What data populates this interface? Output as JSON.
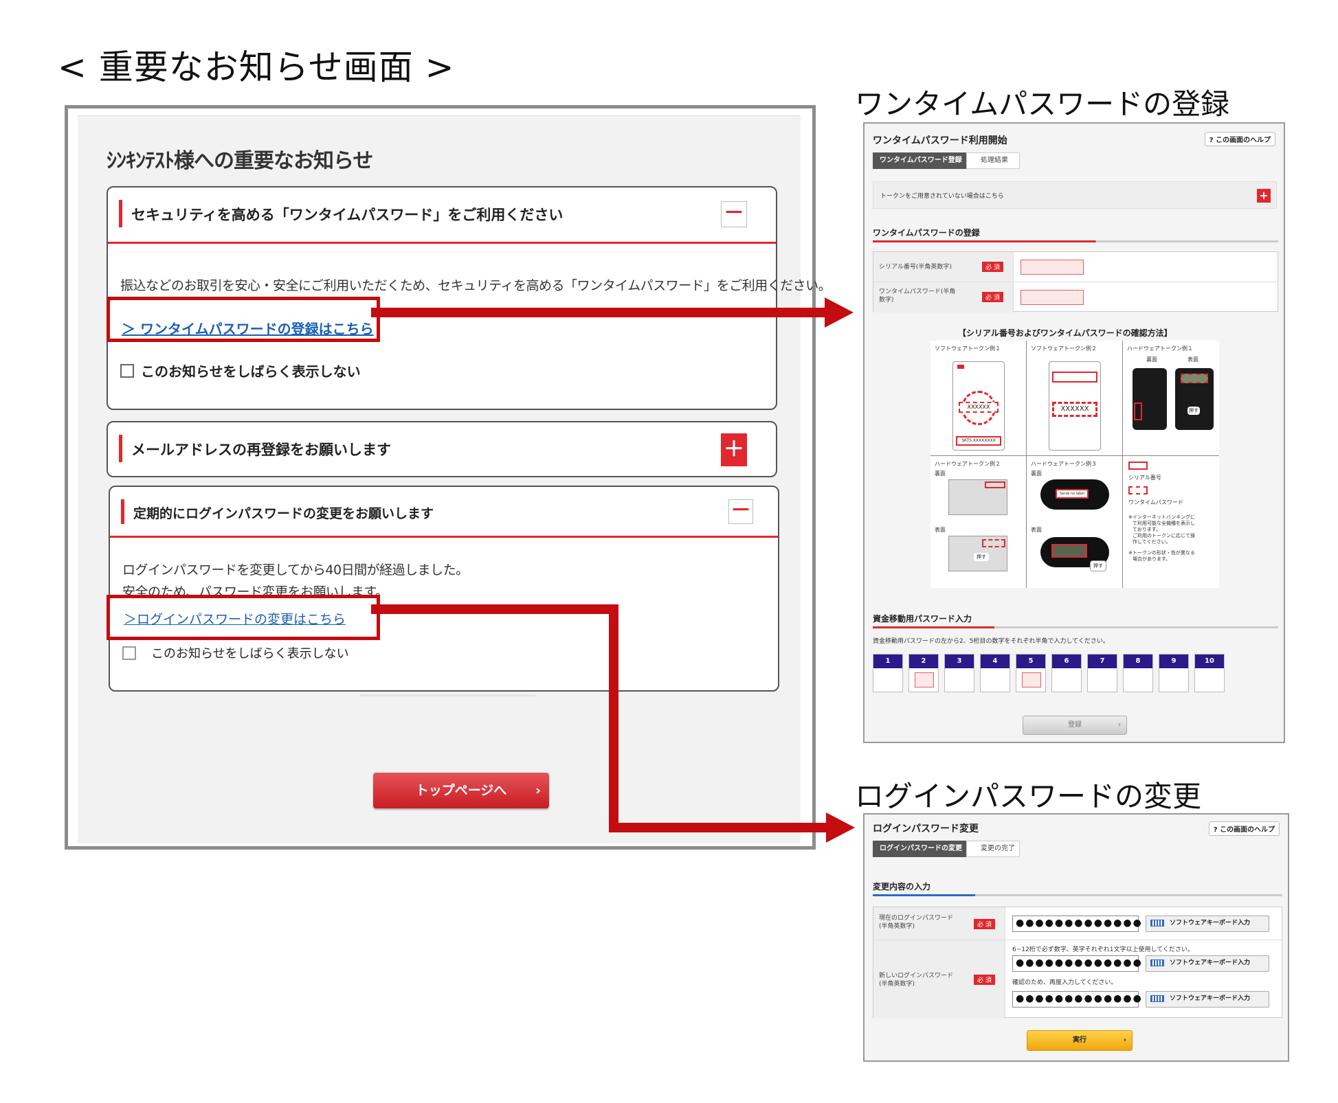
{
  "page_title": "< 重要なお知らせ画面 >",
  "main": {
    "heading": "ｼﾝｷﾝﾃｽﾄ様への重要なお知らせ",
    "sections": [
      {
        "title": "セキュリティを高める「ワンタイムパスワード」をご利用ください",
        "toggle": "－",
        "body": "振込などのお取引を安心・安全にご利用いただくため、セキュリティを高める「ワンタイムパスワード」をご利用ください。",
        "link": "＞ ワンタイムパスワードの登録はこちら",
        "checkbox_label": "このお知らせをしばらく表示しない"
      },
      {
        "title": "メールアドレスの再登録をお願いします",
        "toggle": "＋"
      },
      {
        "title": "定期的にログインパスワードの変更をお願いします",
        "toggle": "－",
        "body_line1": "ログインパスワードを変更してから40日間が経過しました。",
        "body_line2": "安全のため、パスワード変更をお願いします。",
        "link": "＞ログインパスワードの変更はこちら",
        "checkbox_label": "このお知らせをしばらく表示しない"
      }
    ],
    "top_button": "トップページへ",
    "top_button_arrow": "›"
  },
  "otp": {
    "caption": "ワンタイムパスワードの登録",
    "title": "ワンタイムパスワード利用開始",
    "help": "? この画面のヘルプ",
    "step_current": "ワンタイムパスワード登録",
    "step_next": "処理結果",
    "token_notice": "トークンをご用意されていない場合はこちら",
    "token_notice_toggle": "+",
    "section_heading": "ワンタイムパスワードの登録",
    "rows": [
      {
        "label": "シリアル番号(半角英数字)",
        "req": "必 須"
      },
      {
        "label_line1": "ワンタイムパスワード(半角",
        "label_line2": "数字)",
        "req": "必 須"
      }
    ],
    "confirm_caption": "【シリアル番号およびワンタイムパスワードの確認方法】",
    "token_examples": [
      "ソフトウェアトークン例１",
      "ソフトウェアトークン例２",
      "ハードウェアトークン例１",
      "ハードウェアトークン例２",
      "ハードウェアトークン例３"
    ],
    "token_text": {
      "soft_code": "XXXXXX",
      "soft_serial": "SKTS XXXXXXXX",
      "back": "裏面",
      "front": "表面",
      "push": "押す",
      "serial_no_label": "Serial no label",
      "legend_serial": "シリアル番号",
      "legend_otp": "ワンタイムパスワード",
      "note1_line1": "※インターネットバンキングに",
      "note1_line2": "て利用可能な全機種を表示し",
      "note1_line3": "ております。",
      "note1_line4": "ご利用のトークンに応じて操",
      "note1_line5": "作してください。",
      "note2_line1": "※トークンの形状・色が異なる",
      "note2_line2": "場合があります。"
    },
    "transfer_heading": "資金移動用パスワード入力",
    "transfer_note": "資金移動用パスワードの左から2、5桁目の数字をそれぞれ半角で入力してください。",
    "digits": [
      "1",
      "2",
      "3",
      "4",
      "5",
      "6",
      "7",
      "8",
      "9",
      "10"
    ],
    "active_digits": [
      2,
      5
    ],
    "submit": "登録",
    "submit_arrow": "›"
  },
  "login_pw": {
    "caption": "ログインパスワードの変更",
    "title": "ログインパスワード変更",
    "help": "? この画面のヘルプ",
    "step_current": "ログインパスワードの変更",
    "step_next": "変更の完了",
    "section_heading": "変更内容の入力",
    "current_label_line1": "現在のログインパスワード",
    "current_label_line2": "(半角英数字)",
    "new_label_line1": "新しいログインパスワード",
    "new_label_line2": "(半角英数字)",
    "req": "必 須",
    "masked": "●●●●●●●●●●●●●",
    "rule_note": "6~12桁で必ず数字、英字それぞれ1文字以上使用してください。",
    "confirm_note": "確認のため、再度入力してください。",
    "keyboard_btn": "ソフトウェアキーボード入力",
    "submit": "実行",
    "submit_arrow": "›"
  },
  "colors": {
    "accent_red": "#e0282e",
    "highlight_red": "#c30d11",
    "link_blue": "#1a5fb4",
    "digit_header": "#2a1a8a",
    "execute_yellow": "#f2a60c"
  }
}
